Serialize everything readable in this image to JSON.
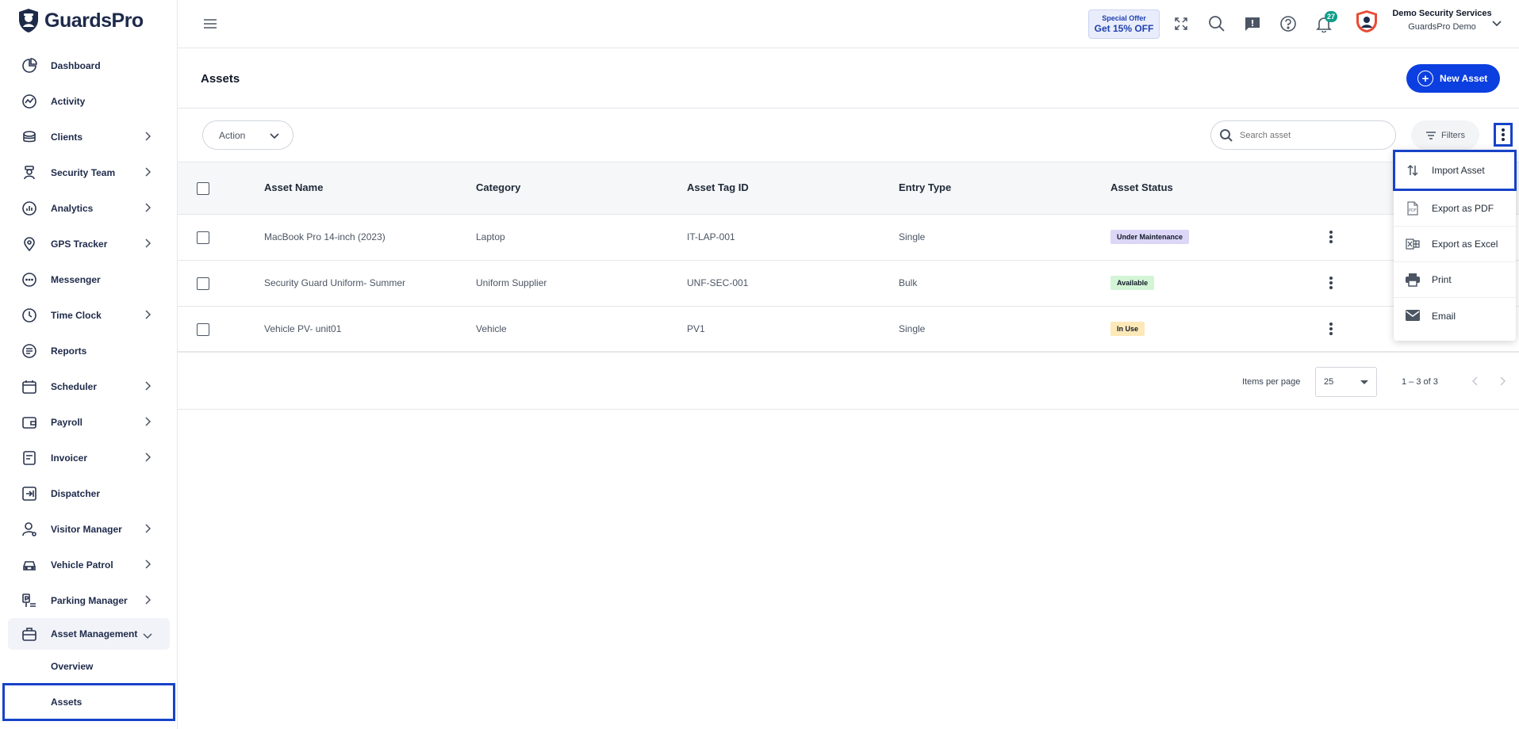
{
  "brand": {
    "name": "GuardsPro"
  },
  "sidebar": {
    "items": [
      {
        "label": "Dashboard",
        "icon": "dashboard-icon",
        "chevron": false
      },
      {
        "label": "Activity",
        "icon": "activity-icon",
        "chevron": false
      },
      {
        "label": "Clients",
        "icon": "clients-icon",
        "chevron": true
      },
      {
        "label": "Security Team",
        "icon": "security-team-icon",
        "chevron": true
      },
      {
        "label": "Analytics",
        "icon": "analytics-icon",
        "chevron": true
      },
      {
        "label": "GPS Tracker",
        "icon": "gps-icon",
        "chevron": true
      },
      {
        "label": "Messenger",
        "icon": "messenger-icon",
        "chevron": false
      },
      {
        "label": "Time Clock",
        "icon": "clock-icon",
        "chevron": true
      },
      {
        "label": "Reports",
        "icon": "reports-icon",
        "chevron": false
      },
      {
        "label": "Scheduler",
        "icon": "calendar-icon",
        "chevron": true
      },
      {
        "label": "Payroll",
        "icon": "wallet-icon",
        "chevron": true
      },
      {
        "label": "Invoicer",
        "icon": "invoice-icon",
        "chevron": true
      },
      {
        "label": "Dispatcher",
        "icon": "dispatch-icon",
        "chevron": false
      },
      {
        "label": "Visitor Manager",
        "icon": "visitor-icon",
        "chevron": true
      },
      {
        "label": "Vehicle Patrol",
        "icon": "car-icon",
        "chevron": true
      },
      {
        "label": "Parking Manager",
        "icon": "parking-icon",
        "chevron": true
      }
    ],
    "active_item": {
      "label": "Asset Management",
      "icon": "briefcase-icon"
    },
    "sub_items": [
      {
        "label": "Overview"
      },
      {
        "label": "Assets"
      }
    ]
  },
  "topbar": {
    "offer_line1": "Special Offer",
    "offer_line2": "Get 15% OFF",
    "notification_count": "27",
    "company_name": "Demo Security Services",
    "user_name": "GuardsPro Demo"
  },
  "page": {
    "title": "Assets",
    "new_button": "New Asset"
  },
  "toolbar": {
    "action_label": "Action",
    "search_placeholder": "Search asset",
    "filters_label": "Filters"
  },
  "table": {
    "columns": [
      "Asset Name",
      "Category",
      "Asset Tag ID",
      "Entry Type",
      "Asset Status"
    ],
    "rows": [
      {
        "name": "MacBook Pro 14-inch (2023)",
        "category": "Laptop",
        "tag": "IT-LAP-001",
        "entry": "Single",
        "status": "Under Maintenance",
        "status_color": "#dcd6f7"
      },
      {
        "name": "Security Guard Uniform- Summer",
        "category": "Uniform Supplier",
        "tag": "UNF-SEC-001",
        "entry": "Bulk",
        "status": "Available",
        "status_color": "#d3f5d6"
      },
      {
        "name": "Vehicle PV- unit01",
        "category": "Vehicle",
        "tag": "PV1",
        "entry": "Single",
        "status": "In Use",
        "status_color": "#fde9b8"
      }
    ]
  },
  "pagination": {
    "items_per_page_label": "Items per page",
    "items_per_page": "25",
    "range": "1 – 3 of 3"
  },
  "menu": {
    "items": [
      {
        "label": "Import Asset",
        "icon": "import-sort-icon"
      },
      {
        "label": "Export as PDF",
        "icon": "pdf-icon"
      },
      {
        "label": "Export as Excel",
        "icon": "excel-icon"
      },
      {
        "label": "Print",
        "icon": "print-icon"
      },
      {
        "label": "Email",
        "icon": "email-icon"
      }
    ]
  },
  "colors": {
    "primary": "#0b3fe0",
    "highlight": "#1743c9",
    "badge": "#0f9d8a"
  }
}
